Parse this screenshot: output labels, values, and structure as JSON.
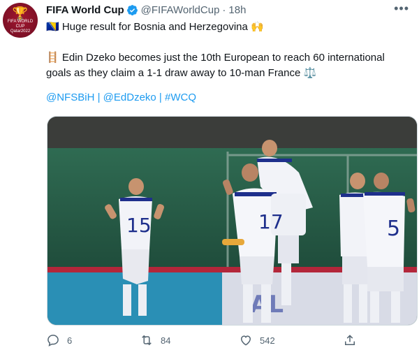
{
  "account": {
    "name": "FIFA World Cup",
    "handle": "@FIFAWorldCup",
    "separator": "·",
    "time": "18h",
    "avatar_text": "FIFA WORLD CUP\nQatar2022"
  },
  "tweet": {
    "line1": "🇧🇦 Huge result for Bosnia and Herzegovina 🙌",
    "line2": "🪜 Edin Dzeko becomes just the 10th European to reach 60 international goals as they claim a 1-1 draw away to 10-man France ⚖️",
    "links": [
      "@NFSBiH",
      "@EdDzeko",
      "#WCQ"
    ],
    "link_separator": "|"
  },
  "photo": {
    "player_numbers": [
      "15",
      "17",
      "5"
    ]
  },
  "stats": {
    "replies": "6",
    "retweets": "84",
    "likes": "542"
  },
  "colors": {
    "link": "#1d9bf0",
    "muted": "#536471",
    "verified": "#1d9bf0",
    "avatar": "#7d1026"
  }
}
